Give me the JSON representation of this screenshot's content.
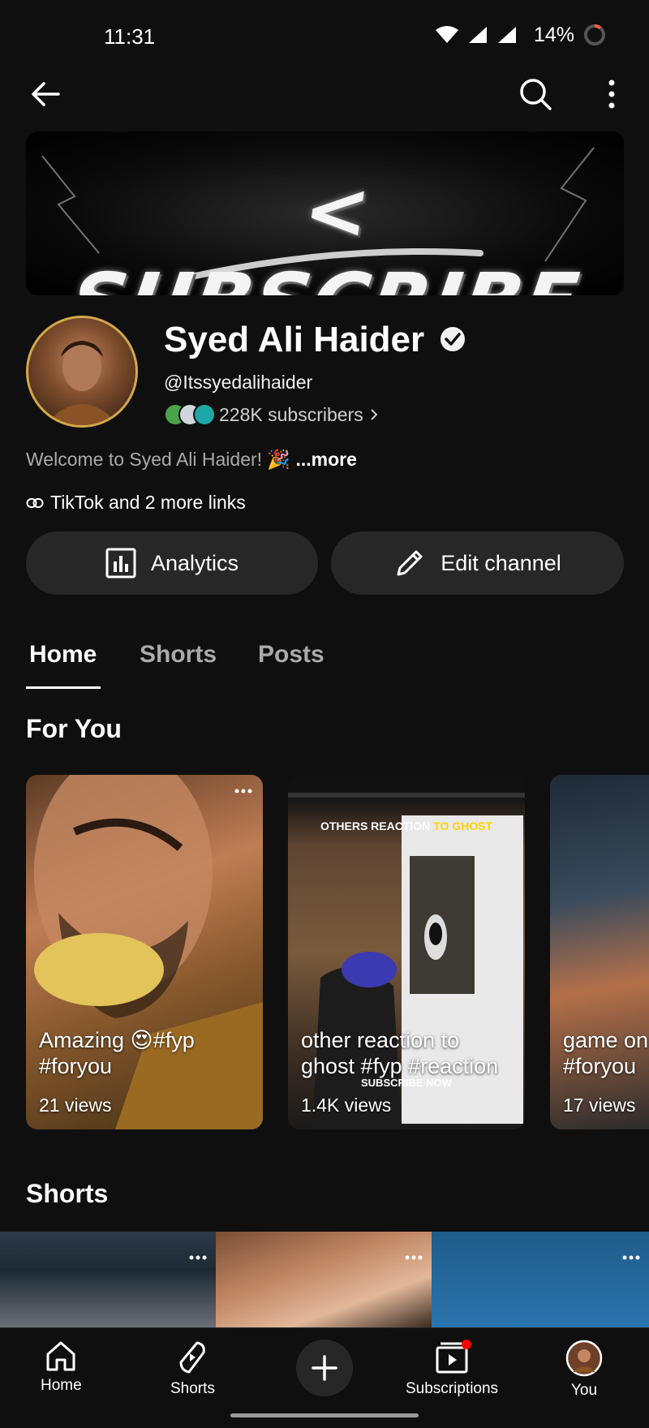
{
  "status_bar": {
    "time": "11:31",
    "battery": "14%"
  },
  "channel": {
    "banner_text": "< SUBSCRIBE >",
    "name": "Syed Ali Haider",
    "handle": "@Itssyedalihaider",
    "subscribers": "228K subscribers",
    "description": "Welcome to Syed Ali Haider! 🎉",
    "more_label": "...more",
    "links_label": "TikTok and 2 more links"
  },
  "actions": {
    "analytics_label": "Analytics",
    "edit_label": "Edit channel"
  },
  "tabs": [
    {
      "label": "Home",
      "active": true
    },
    {
      "label": "Shorts",
      "active": false
    },
    {
      "label": "Posts",
      "active": false
    }
  ],
  "sections": {
    "for_you": "For You",
    "shorts": "Shorts"
  },
  "for_you_cards": [
    {
      "caption": "Amazing 😍#fyp #foryou",
      "views": "21 views"
    },
    {
      "caption": "other reaction to ghost #fyp #reaction",
      "views": "1.4K views",
      "overlay_a": "OTHERS REACTION",
      "overlay_b": "TO GHOST",
      "overlay_sub": "SUBSCRIBE NOW"
    },
    {
      "caption": "game on #foryou",
      "views": "17 views"
    }
  ],
  "bottom_nav": {
    "home": "Home",
    "shorts": "Shorts",
    "subscriptions": "Subscriptions",
    "you": "You"
  },
  "colors": {
    "background": "#0f0f0f",
    "button_bg": "#272727",
    "avatar_ring": "#d4a84a",
    "notification_dot": "#ff0000"
  }
}
